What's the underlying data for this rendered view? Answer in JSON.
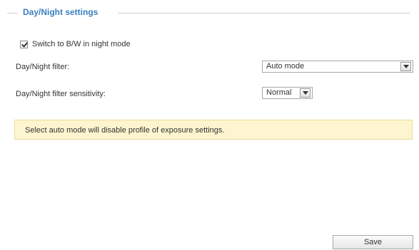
{
  "section": {
    "title": "Day/Night settings"
  },
  "bw_night_mode": {
    "label": "Switch to B/W in night mode",
    "checked": true
  },
  "filter": {
    "label": "Day/Night filter:",
    "value": "Auto mode"
  },
  "sensitivity": {
    "label": "Day/Night filter sensitivity:",
    "value": "Normal"
  },
  "notice": {
    "text": "Select auto mode will disable profile of exposure settings."
  },
  "actions": {
    "save_label": "Save"
  }
}
